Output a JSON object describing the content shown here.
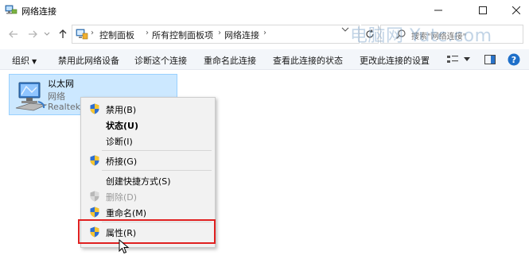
{
  "window": {
    "title": "网络连接",
    "icon": "network-connections-icon"
  },
  "address_bar": {
    "breadcrumbs": [
      "控制面板",
      "所有控制面板项",
      "网络连接"
    ],
    "search_placeholder": "搜索\"网络连接\"",
    "watermark": "电脑网 Yutc.com"
  },
  "command_bar": {
    "organize": "组织",
    "items": [
      "禁用此网络设备",
      "诊断这个连接",
      "重命名此连接",
      "查看此连接的状态",
      "更改此连接的设置"
    ]
  },
  "connection": {
    "name": "以太网",
    "status": "网络",
    "device": "Realtek",
    "icon": "ethernet-adapter-icon"
  },
  "context_menu": {
    "items": [
      {
        "label": "禁用(B)",
        "icon": "shield-icon",
        "bold": false,
        "disabled": false
      },
      {
        "label": "状态(U)",
        "icon": "",
        "bold": true,
        "disabled": false
      },
      {
        "label": "诊断(I)",
        "icon": "",
        "bold": false,
        "disabled": false
      },
      {
        "label": "桥接(G)",
        "icon": "shield-icon",
        "bold": false,
        "disabled": false
      },
      {
        "label": "创建快捷方式(S)",
        "icon": "",
        "bold": false,
        "disabled": false
      },
      {
        "label": "删除(D)",
        "icon": "shield-icon",
        "bold": false,
        "disabled": true
      },
      {
        "label": "重命名(M)",
        "icon": "shield-icon",
        "bold": false,
        "disabled": false
      },
      {
        "label": "属性(R)",
        "icon": "shield-icon",
        "bold": false,
        "disabled": false
      }
    ],
    "highlighted_item": "属性(R)",
    "highlight_color": "#e02020"
  },
  "colors": {
    "selection_fill": "#cce8ff",
    "selection_border": "#99d1ff",
    "command_bar_bg": "#f3f6fa"
  }
}
